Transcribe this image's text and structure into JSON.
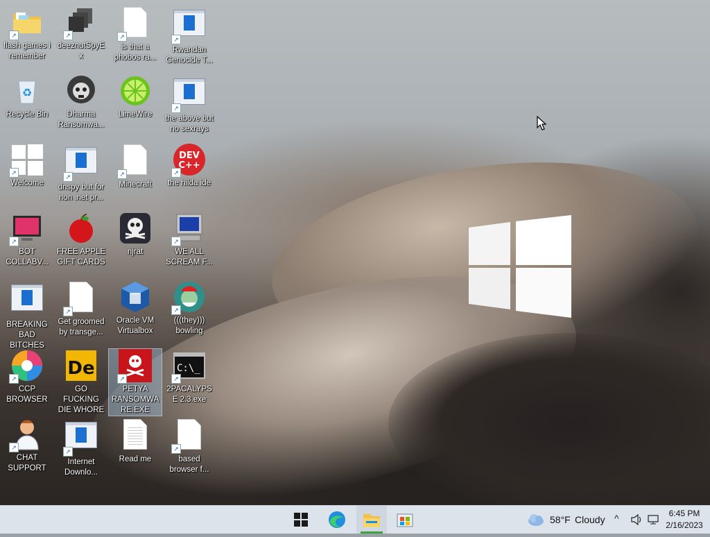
{
  "desktop_icons": [
    {
      "label": "flash games i remember",
      "icon": "folder-icon"
    },
    {
      "label": "deeznutSpyEx",
      "icon": "stacked-windows-icon"
    },
    {
      "label": "is that a phobos ra...",
      "icon": "blank-file-icon"
    },
    {
      "label": "Rwandan Genocide T...",
      "icon": "app-window-icon"
    },
    {
      "label": "Recycle Bin",
      "icon": "recycle-bin-icon"
    },
    {
      "label": "Dharma Ransomwa...",
      "icon": "skull-helmet-icon"
    },
    {
      "label": "LimeWire",
      "icon": "lime-icon"
    },
    {
      "label": "the above but no sexrays",
      "icon": "app-window-icon"
    },
    {
      "label": "Welcome",
      "icon": "windows-logo-icon"
    },
    {
      "label": "dnspy but for non .net pr...",
      "icon": "app-window-icon"
    },
    {
      "label": "Minecraft",
      "icon": "blank-file-icon"
    },
    {
      "label": "the hilda ide",
      "icon": "dev-cpp-icon"
    },
    {
      "label": "BOT COLLABV...",
      "icon": "monitor-icon"
    },
    {
      "label": "FREE APPLE GIFT CARDS",
      "icon": "apple-icon"
    },
    {
      "label": "njrat",
      "icon": "skull-icon"
    },
    {
      "label": "WE ALL SCREAM F...",
      "icon": "old-computer-icon"
    },
    {
      "label": "BREAKING BAD BITCHES",
      "icon": "app-window-icon"
    },
    {
      "label": "Get groomed by transge...",
      "icon": "blank-file-icon"
    },
    {
      "label": "Oracle VM Virtualbox",
      "icon": "virtualbox-icon"
    },
    {
      "label": "(((they))) bowling",
      "icon": "santa-icon"
    },
    {
      "label": "CCP BROWSER",
      "icon": "pinwheel-icon"
    },
    {
      "label": "GO FUCKING DIE WHORE",
      "icon": "de-icon"
    },
    {
      "label": "PETYA RANSOMWARE.EXE",
      "icon": "red-skull-icon"
    },
    {
      "label": "2PACALYPSE 2.3.exe",
      "icon": "console-icon"
    },
    {
      "label": "CHAT SUPPORT",
      "icon": "doctor-icon"
    },
    {
      "label": "Internet Downlo...",
      "icon": "app-window-icon"
    },
    {
      "label": "Read me",
      "icon": "text-file-icon"
    },
    {
      "label": "based browser f...",
      "icon": "blank-file-icon"
    }
  ],
  "selected_icon": "PETYA RANSOMWARE.EXE",
  "taskbar": {
    "buttons": [
      "start-icon",
      "edge-icon",
      "file-explorer-icon",
      "store-icon"
    ],
    "weather": {
      "temp": "58°F",
      "condition": "Cloudy"
    },
    "clock": {
      "time": "6:45 PM",
      "date": "2/16/2023"
    }
  },
  "colors": {
    "taskbar": "#dde3ea",
    "active_indicator": "#3ea03e",
    "selection": "#a0bed7"
  }
}
